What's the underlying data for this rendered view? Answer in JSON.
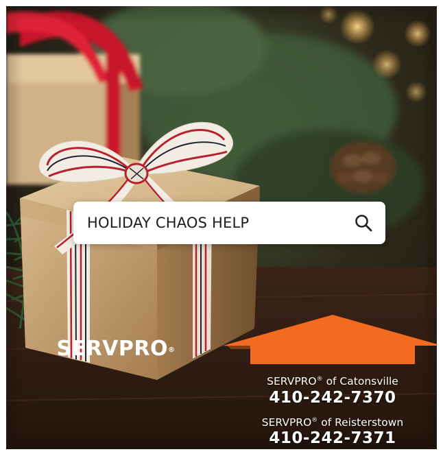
{
  "search": {
    "query": "HOLIDAY CHAOS HELP",
    "icon": "search-icon"
  },
  "logo": {
    "wordmark": "SERVPRO",
    "trademark": "®",
    "color": "#f26b21"
  },
  "locations": [
    {
      "brand": "SERVPRO",
      "registered": "®",
      "suffix": " of Catonsville",
      "phone": "410-242-7370"
    },
    {
      "brand": "SERVPRO",
      "registered": "®",
      "suffix": " of Reisterstown",
      "phone": "410-242-7371"
    }
  ],
  "scene": {
    "description_icons": [
      "gift-box",
      "ribbon-bow",
      "pine-branch",
      "pine-cone",
      "bokeh-lights"
    ]
  }
}
